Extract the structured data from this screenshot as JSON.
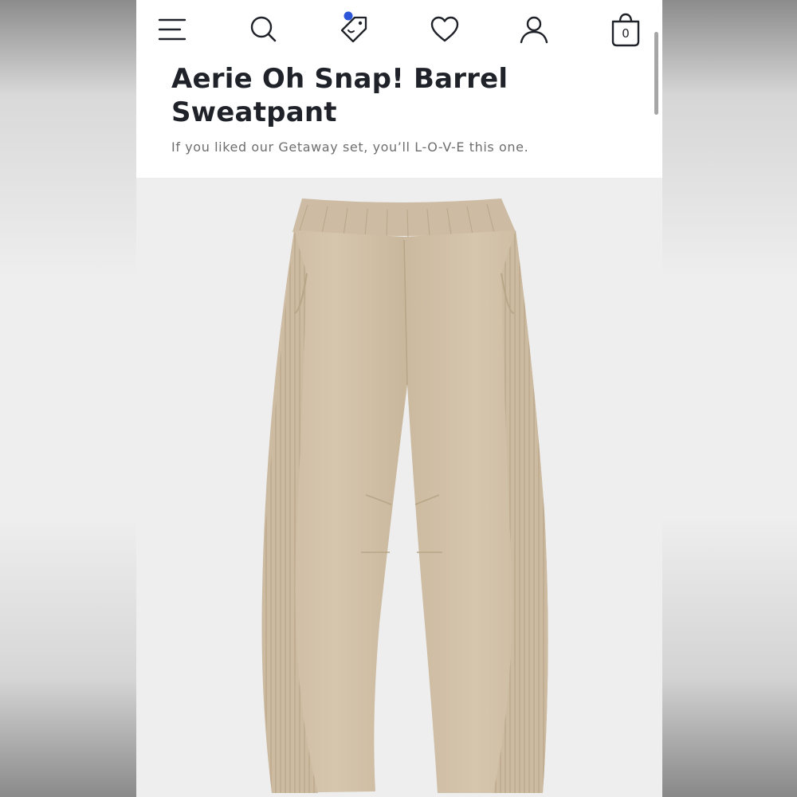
{
  "header": {
    "icons": [
      "menu-icon",
      "search-icon",
      "tag-icon",
      "heart-icon",
      "account-icon",
      "shopping-bag-icon"
    ],
    "bag_count": "0",
    "accent_color": "#2c55d9",
    "text_color": "#1f2228"
  },
  "product": {
    "title": "Aerie Oh Snap! Barrel Sweatpant",
    "subtitle": "If you liked our Getaway set, you’ll L-O-V-E this one.",
    "image_alt": "Beige barrel sweatpants with ribbed side panels",
    "garment_color": "#d4c3ab"
  }
}
